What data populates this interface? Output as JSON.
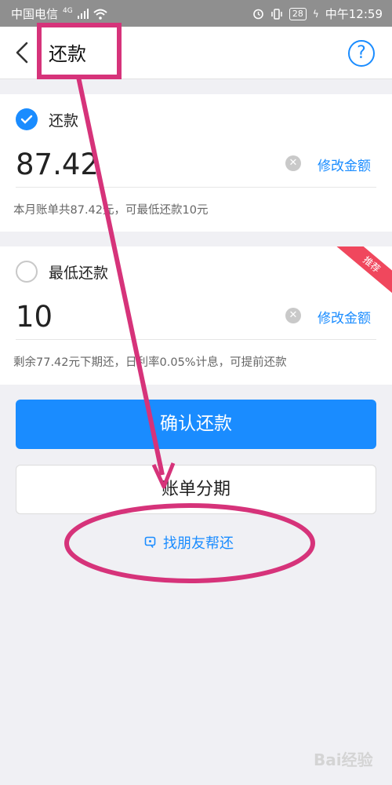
{
  "status_bar": {
    "carrier": "中国电信",
    "network": "4G",
    "battery": "28",
    "time": "中午12:59"
  },
  "nav": {
    "title": "还款",
    "help_symbol": "?"
  },
  "full_repay": {
    "label": "还款",
    "amount": "87.42",
    "modify_label": "修改金额",
    "note": "本月账单共87.42元，可最低还款10元",
    "selected": true
  },
  "min_repay": {
    "label": "最低还款",
    "amount": "10",
    "modify_label": "修改金额",
    "note": "剩余77.42元下期还，日利率0.05%计息，可提前还款",
    "badge": "推荐",
    "selected": false
  },
  "actions": {
    "confirm_label": "确认还款",
    "installment_label": "账单分期",
    "friend_help_label": "找朋友帮还"
  },
  "watermark": "Bai经验",
  "colors": {
    "accent": "#1a8cff",
    "annotation": "#d6337a",
    "badge": "#f0475d"
  }
}
